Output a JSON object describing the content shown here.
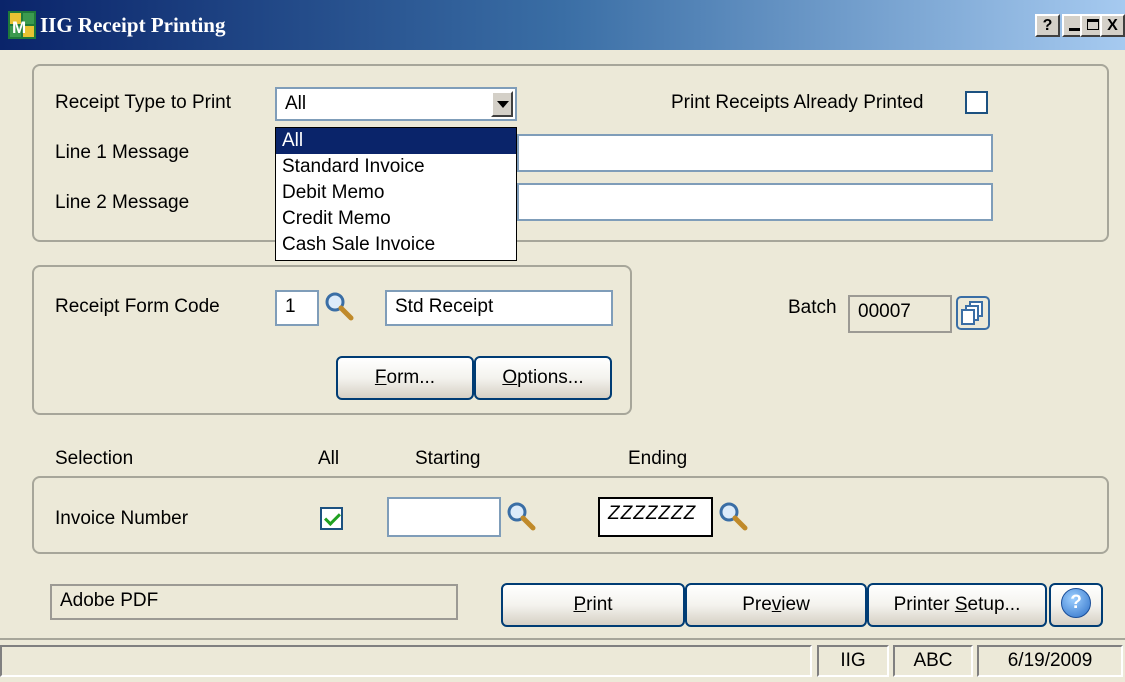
{
  "window": {
    "title": "IIG Receipt Printing",
    "help_btn": "?",
    "minimize_btn": "_",
    "close_btn": "X"
  },
  "receipt": {
    "type_label": "Receipt Type to Print",
    "type_value": "All",
    "type_options": [
      "All",
      "Standard Invoice",
      "Debit Memo",
      "Credit Memo",
      "Cash Sale Invoice"
    ],
    "print_already_label": "Print Receipts Already Printed",
    "line1_label": "Line 1 Message",
    "line1_value": "",
    "line2_label": "Line 2 Message",
    "line2_value": ""
  },
  "form": {
    "code_label": "Receipt Form Code",
    "code_value": "1",
    "desc_value": "Std Receipt",
    "form_btn_pre": "",
    "form_btn_ul": "F",
    "form_btn_post": "orm...",
    "options_btn_pre": "",
    "options_btn_ul": "O",
    "options_btn_post": "ptions...",
    "batch_label": "Batch",
    "batch_value": "00007"
  },
  "selection": {
    "header": "Selection",
    "all_header": "All",
    "starting_header": "Starting",
    "ending_header": "Ending",
    "row_label": "Invoice Number",
    "all_checked": true,
    "starting_value": "",
    "ending_value": "ZZZZZZZ"
  },
  "footer": {
    "printer_value": "Adobe PDF",
    "print_pre": "",
    "print_ul": "P",
    "print_post": "rint",
    "preview_pre": "Pre",
    "preview_ul": "v",
    "preview_post": "iew",
    "setup_pre": "Printer ",
    "setup_ul": "S",
    "setup_post": "etup...",
    "help_glyph": "?"
  },
  "status": {
    "message": "",
    "company_user": "IIG",
    "company_code": "ABC",
    "date": "6/19/2009"
  },
  "colors": {
    "title_bar": "#0A246A",
    "button_border": "#003C74",
    "check_mark": "#21A121",
    "selection_highlight": "#0A246A"
  }
}
